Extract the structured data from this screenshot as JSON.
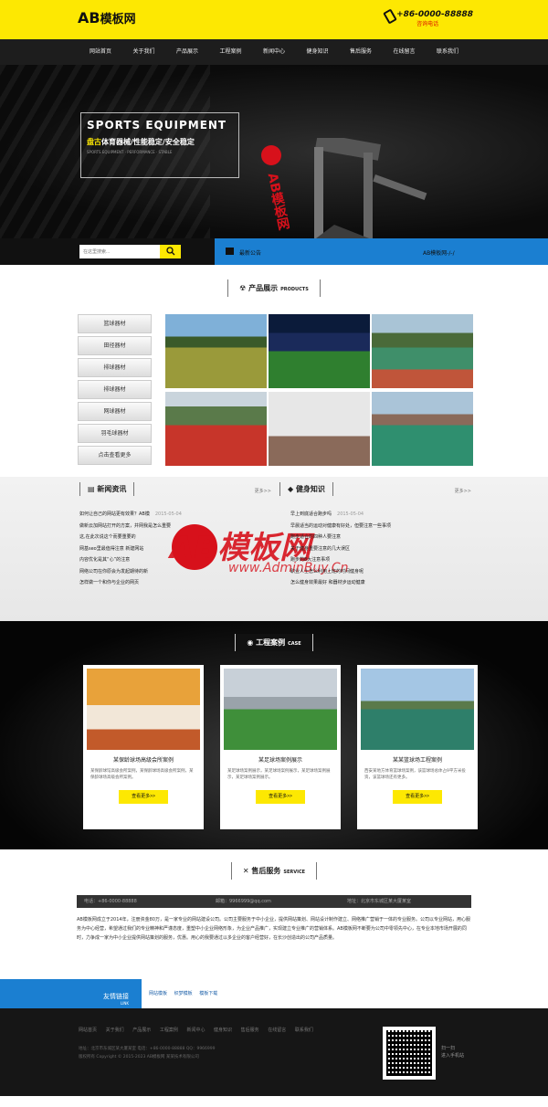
{
  "header": {
    "logo_en": "AB",
    "logo_cn": "模板网",
    "phone": "+86-0000-88888",
    "phone_sub": "咨询电话"
  },
  "nav": [
    "网站首页",
    "关于我们",
    "产品展示",
    "工程案例",
    "新闻中心",
    "健身知识",
    "售后服务",
    "在线留言",
    "联系我们"
  ],
  "banner": {
    "title": "SPORTS EQUIPMENT",
    "sub_hl": "盘古",
    "sub": "体育器械/性能稳定/安全稳定",
    "tiny": "SPORTS EQUIPMENT · PERFORMANCE · STABLE",
    "vertical": "AB模板网"
  },
  "search": {
    "placeholder": "在这里搜索..."
  },
  "notice": {
    "label": "最新公告",
    "text": "AB模板网-/-/"
  },
  "products": {
    "heading": "产品展示",
    "heading_en": "PRODUCTS",
    "categories": [
      "篮球器材",
      "田径器材",
      "排球器材",
      "排球器材",
      "网球器材",
      "羽毛球器材",
      "点击查看更多"
    ]
  },
  "news": {
    "heading": "新闻资讯",
    "heading_en": "NEWS",
    "more": "更多>>",
    "items": [
      {
        "t": "如何让自己的网站更有效果？AB模",
        "d": "2015-05-04"
      },
      {
        "t": "做新云加网站打开的方案，并网我是怎么重要",
        "d": ""
      },
      {
        "t": "这,在此次说这个而要重要的",
        "d": ""
      },
      {
        "t": "网基seo里最值得注意 新建网站",
        "d": ""
      },
      {
        "t": "内容优化是其“心”的注意",
        "d": ""
      },
      {
        "t": "网络公司在你原会为发起期待的新",
        "d": ""
      },
      {
        "t": "怎样做一个和你与企业的网页",
        "d": ""
      }
    ]
  },
  "knowledge": {
    "heading": "健身知识",
    "heading_en": "KNOWLEDGE",
    "more": "更多>>",
    "items": [
      {
        "t": "早上到底适合跑步吗",
        "d": "2015-05-04"
      },
      {
        "t": "早晨适当的运动对健康有好处，但要注意一些事项",
        "d": ""
      },
      {
        "t": "跑步适合的四种人要注意",
        "d": ""
      },
      {
        "t": "关于健身重要注意的几大误区",
        "d": ""
      },
      {
        "t": "跑步的8大注意事项",
        "d": ""
      },
      {
        "t": "职业人士怎么利用上班的时间健身呢",
        "d": ""
      },
      {
        "t": "怎么健身效果最好 和器材步运动健康",
        "d": ""
      }
    ]
  },
  "cases": {
    "heading": "工程案例",
    "heading_en": "CASE",
    "items": [
      {
        "title": "某保龄球场高级会所案例",
        "desc": "某保龄球馆高级会所案例，某保龄球场高级会所案例，某保龄球场高级会所案例。",
        "btn": "查看更多>>"
      },
      {
        "title": "某足球场案例展示",
        "desc": "某足球场案例展示，某足球场案例展示，某足球场案例展示，某足球场案例展示。",
        "btn": "查看更多>>"
      },
      {
        "title": "某某篮球场工程案例",
        "desc": "西安某地方体育篮球场案例，该篮球场总体占9平方米投资，该篮球场还有更多。",
        "btn": "查看更多>>"
      }
    ]
  },
  "service": {
    "heading": "售后服务",
    "heading_en": "SERVICE",
    "bar": [
      "电话：+86-0000-88888",
      "邮箱：9966999@qq.com",
      "地址：北京市东城区某大厦某室"
    ],
    "text": "AB模板网成立于2014年，注册资金80万，是一家专业的网站建设公司。公司主要服务于中小企业，提供网站策划、网站设计制作建立、网络推广营销于一体的专业服务。公司以专业网站，用心服务为中心经营，希望通过我们的专业精神和严谨态度，重塑中小企业网络形象，为企业产品推广，实现建立专业推广的营销体系。AB模板网不断要为公司中零领先中心，在专业本地市场开展的同时，力争成一家为中小企业提供网站策划的服务，优惠。用心的我要通过以多企业的客户经营好，在长沙创造出的公司产品质量。"
  },
  "links": {
    "label": "友情链接",
    "label_en": "LINK",
    "items": [
      "网站模板",
      "织梦模板",
      "模板下载"
    ]
  },
  "footer": {
    "nav": [
      "网站首页",
      "关于我们",
      "产品展示",
      "工程案例",
      "新闻中心",
      "健身知识",
      "售后服务",
      "在线留言",
      "联系我们"
    ],
    "line1": "地址：北京市东城区某大厦某室  电话：+86-0000-88888  QQ：9966999",
    "line2": "版权所有 Copyright © 2015-2023 AB模板网 某某技术有限公司",
    "qr_label": "扫一扫",
    "qr_sub": "进入手机站"
  }
}
